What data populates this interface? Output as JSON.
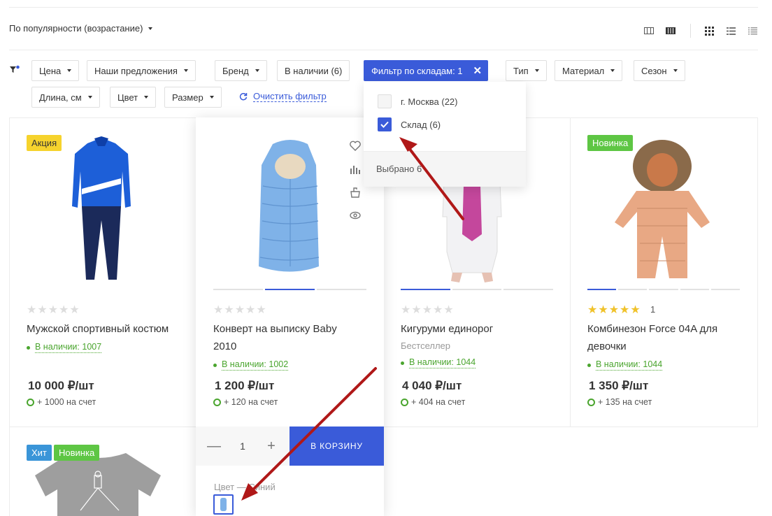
{
  "toolbar": {
    "sort_label": "По популярности (возрастание)",
    "view_icons": [
      "grid-tiles-icon",
      "grid-list-icon",
      "grid-table-icon",
      "cards-icon",
      "list-icon",
      "compact-list-icon"
    ]
  },
  "filters": {
    "chips": [
      {
        "label": "Цена"
      },
      {
        "label": "Наши предложения"
      },
      {
        "label": "Бренд"
      },
      {
        "label": "В наличии (6)"
      },
      {
        "label": "Фильтр по складам: 1",
        "active": true
      },
      {
        "label": "Тип"
      },
      {
        "label": "Материал"
      },
      {
        "label": "Сезон"
      },
      {
        "label": "Длина, см"
      },
      {
        "label": "Цвет"
      },
      {
        "label": "Размер"
      }
    ],
    "clear_label": "Очистить фильтр",
    "dropdown": {
      "options": [
        {
          "label": "г. Москва (22)",
          "checked": false
        },
        {
          "label": "Склад (6)",
          "checked": true
        }
      ],
      "selected_label": "Выбрано 6"
    }
  },
  "products": [
    {
      "badges": [
        "Акция"
      ],
      "title": "Мужской спортивный костюм",
      "availability": "В наличии: 1007",
      "price": "10 000 ₽/шт",
      "bonus": "+ 1000 на счет",
      "rating": 0
    },
    {
      "title_line1": "Конверт на выписку Baby",
      "title_line2": "2010",
      "availability": "В наличии: 1002",
      "price": "1 200 ₽/шт",
      "bonus": "+ 120 на счет",
      "rating": 0
    },
    {
      "title": "Кигуруми единорог",
      "subtitle": "Бестселлер",
      "availability": "В наличии: 1044",
      "price": "4 040 ₽/шт",
      "bonus": "+ 404 на счет",
      "rating": 0
    },
    {
      "badges": [
        "Новинка"
      ],
      "title_line1": "Комбинезон Force 04A для",
      "title_line2": "девочки",
      "availability": "В наличии: 1044",
      "price": "1 350 ₽/шт",
      "bonus": "+ 135 на счет",
      "rating": 5,
      "rating_count": "1"
    },
    {
      "badges": [
        "Хит",
        "Новинка"
      ]
    }
  ],
  "hover_card": {
    "qty_minus": "—",
    "qty_value": "1",
    "qty_plus": "+",
    "cart_label": "В КОРЗИНУ",
    "color_label": "Цвет — Синий"
  },
  "stars_empty": "★★★★★",
  "stars_full": "★★★★★",
  "colors": {
    "accent": "#3a5bd9",
    "green": "#4aa52e",
    "sale": "#f6d32d",
    "new": "#5ec644",
    "hit": "#3a95d8"
  }
}
